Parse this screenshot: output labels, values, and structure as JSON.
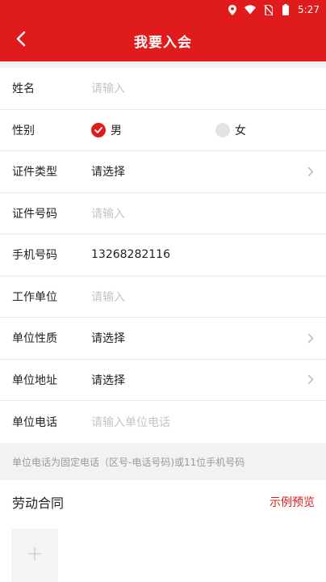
{
  "status_bar": {
    "time": "5:27",
    "icons": [
      "location-icon",
      "wifi-icon",
      "no-sim-icon",
      "battery-icon"
    ]
  },
  "header": {
    "title": "我要入会",
    "back_icon": "chevron-left-icon"
  },
  "form": {
    "name": {
      "label": "姓名",
      "placeholder": "请输入"
    },
    "gender": {
      "label": "性别",
      "options": [
        "男",
        "女"
      ],
      "selected": "男"
    },
    "id_type": {
      "label": "证件类型",
      "value": "请选择"
    },
    "id_number": {
      "label": "证件号码",
      "placeholder": "请输入"
    },
    "phone": {
      "label": "手机号码",
      "value": "13268282116"
    },
    "employer": {
      "label": "工作单位",
      "placeholder": "请输入"
    },
    "employer_type": {
      "label": "单位性质",
      "value": "请选择"
    },
    "employer_address": {
      "label": "单位地址",
      "value": "请选择"
    },
    "employer_phone": {
      "label": "单位电话",
      "placeholder": "请输入单位电话"
    }
  },
  "hint": "单位电话为固定电话（区号-电话号码)或11位手机号码",
  "contract": {
    "title": "劳动合同",
    "sample_link": "示例预览"
  },
  "colors": {
    "accent": "#e01b1b",
    "placeholder": "#c4c4c4",
    "hint": "#9a9a9a"
  }
}
